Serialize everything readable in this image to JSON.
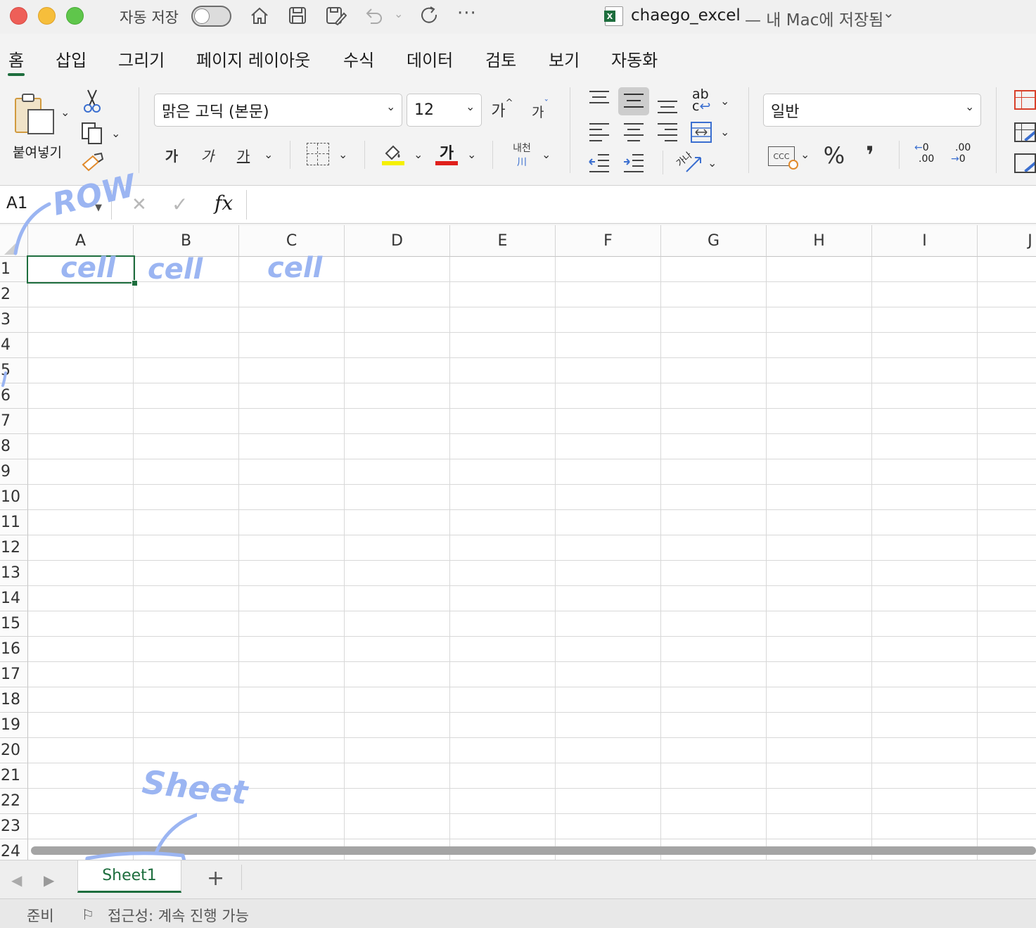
{
  "window": {
    "autosave_label": "자동 저장",
    "title": "chaego_excel",
    "title_suffix": "— 내 Mac에 저장됨",
    "title_chevron": "⌄",
    "more": "···"
  },
  "ribbon_tabs": [
    "홈",
    "삽입",
    "그리기",
    "페이지 레이아웃",
    "수식",
    "데이터",
    "검토",
    "보기",
    "자동화"
  ],
  "ribbon": {
    "paste_label": "붙여넣기",
    "font_name": "맑은 고딕 (본문)",
    "font_size": "12",
    "grow_font": "가",
    "shrink_font": "가",
    "bold": "가",
    "italic": "가",
    "underline": "가",
    "font_color_glyph": "가",
    "phonetic_top": "내천",
    "phonetic_bottom": "川",
    "wrap_top": "ab",
    "wrap_bottom": "c",
    "orientation_glyph": "가나",
    "number_format": "일반",
    "percent": "%",
    "comma": "❜",
    "inc_decimal_a": "0",
    "inc_decimal_b": ".00",
    "dec_decimal_a": ".00",
    "dec_decimal_b": "0",
    "currency_glyph": "CCC",
    "colors": {
      "highlight": "#f5f000",
      "font_color": "#e0201c",
      "accent_green": "#1e6e3e",
      "tab_underline": "#1e6e3e"
    }
  },
  "formula_bar": {
    "name_box": "A1",
    "cancel": "✕",
    "enter": "✓",
    "fx": "fx",
    "formula": ""
  },
  "columns": [
    "A",
    "B",
    "C",
    "D",
    "E",
    "F",
    "G",
    "H",
    "I",
    "J"
  ],
  "rows": [
    "1",
    "2",
    "3",
    "4",
    "5",
    "6",
    "7",
    "8",
    "9",
    "10",
    "11",
    "12",
    "13",
    "14",
    "15",
    "16",
    "17",
    "18",
    "19",
    "20",
    "21",
    "22",
    "23",
    "24"
  ],
  "annotations": {
    "row_note": "ROW",
    "cell_a": "cell",
    "cell_b": "cell",
    "cell_c": "cell",
    "sheet_note": "Sheet",
    "color": "#9bb5f2"
  },
  "sheets": {
    "active": "Sheet1",
    "add": "+",
    "prev": "◀",
    "next": "▶"
  },
  "status": {
    "ready": "준비",
    "accessibility": "접근성: 계속 진행 가능"
  }
}
